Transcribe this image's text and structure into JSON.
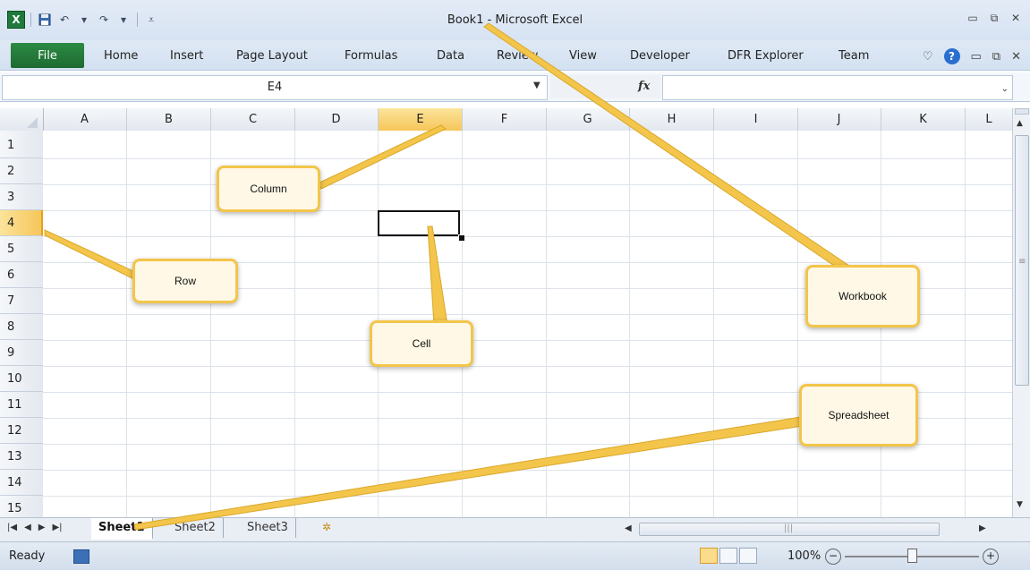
{
  "titlebar": {
    "app_icon": "excel-logo-icon",
    "app_icon_text": "X",
    "quick_access": [
      "save-icon",
      "undo-icon",
      "redo-icon",
      "customize-icon"
    ],
    "title": "Book1  -  Microsoft Excel"
  },
  "ribbon": {
    "file_label": "File",
    "tabs": [
      "Home",
      "Insert",
      "Page Layout",
      "Formulas",
      "Data",
      "Review",
      "View",
      "Developer",
      "DFR Explorer",
      "Team"
    ]
  },
  "formula_bar": {
    "name_box": "E4",
    "fx_label": "fx",
    "formula": ""
  },
  "grid": {
    "columns": [
      "A",
      "B",
      "C",
      "D",
      "E",
      "F",
      "G",
      "H",
      "I",
      "J",
      "K",
      "L"
    ],
    "rows": [
      "1",
      "2",
      "3",
      "4",
      "5",
      "6",
      "7",
      "8",
      "9",
      "10",
      "11",
      "12",
      "13",
      "14",
      "15"
    ],
    "selected_column": "E",
    "selected_row": "4"
  },
  "sheets": {
    "tabs": [
      "Sheet1",
      "Sheet2",
      "Sheet3"
    ],
    "active": "Sheet1"
  },
  "status": {
    "text": "Ready",
    "zoom": "100%",
    "zoom_level_fraction": 0.5
  },
  "callouts": {
    "column": "Column",
    "row": "Row",
    "cell": "Cell",
    "workbook": "Workbook",
    "spreadsheet": "Spreadsheet"
  },
  "colors": {
    "accent_green": "#1f7a3c",
    "selection_highlight": "#f6c65a",
    "callout_border": "#f3c54a"
  }
}
